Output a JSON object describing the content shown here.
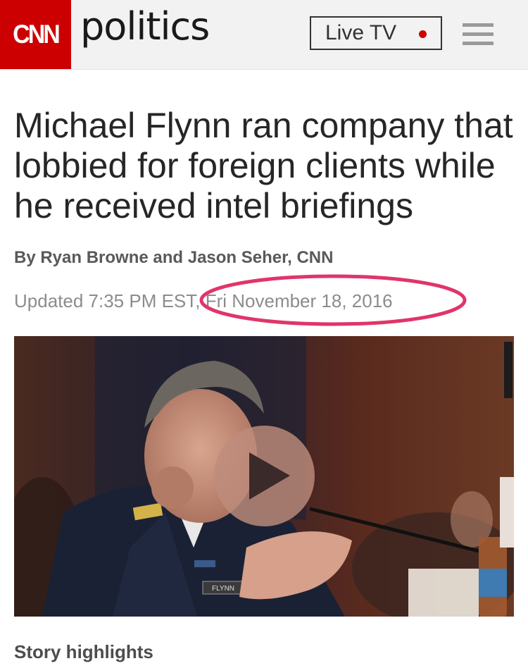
{
  "header": {
    "logo": "CNN",
    "section": "politics",
    "live_tv_label": "Live TV",
    "menu_icon": "hamburger-menu-icon"
  },
  "article": {
    "headline": "Michael Flynn ran company that lobbied for foreign clients while he received intel briefings",
    "byline": "By Ryan Browne and Jason Seher, CNN",
    "updated": "Updated 7:35 PM EST, Fri November 18, 2016",
    "video": {
      "play_icon": "play-icon",
      "name_plate": "FLYNN"
    },
    "story_highlights_label": "Story highlights"
  },
  "colors": {
    "brand_red": "#cc0000",
    "annotation_pink": "#e0356a",
    "header_bg": "#f2f2f2"
  }
}
